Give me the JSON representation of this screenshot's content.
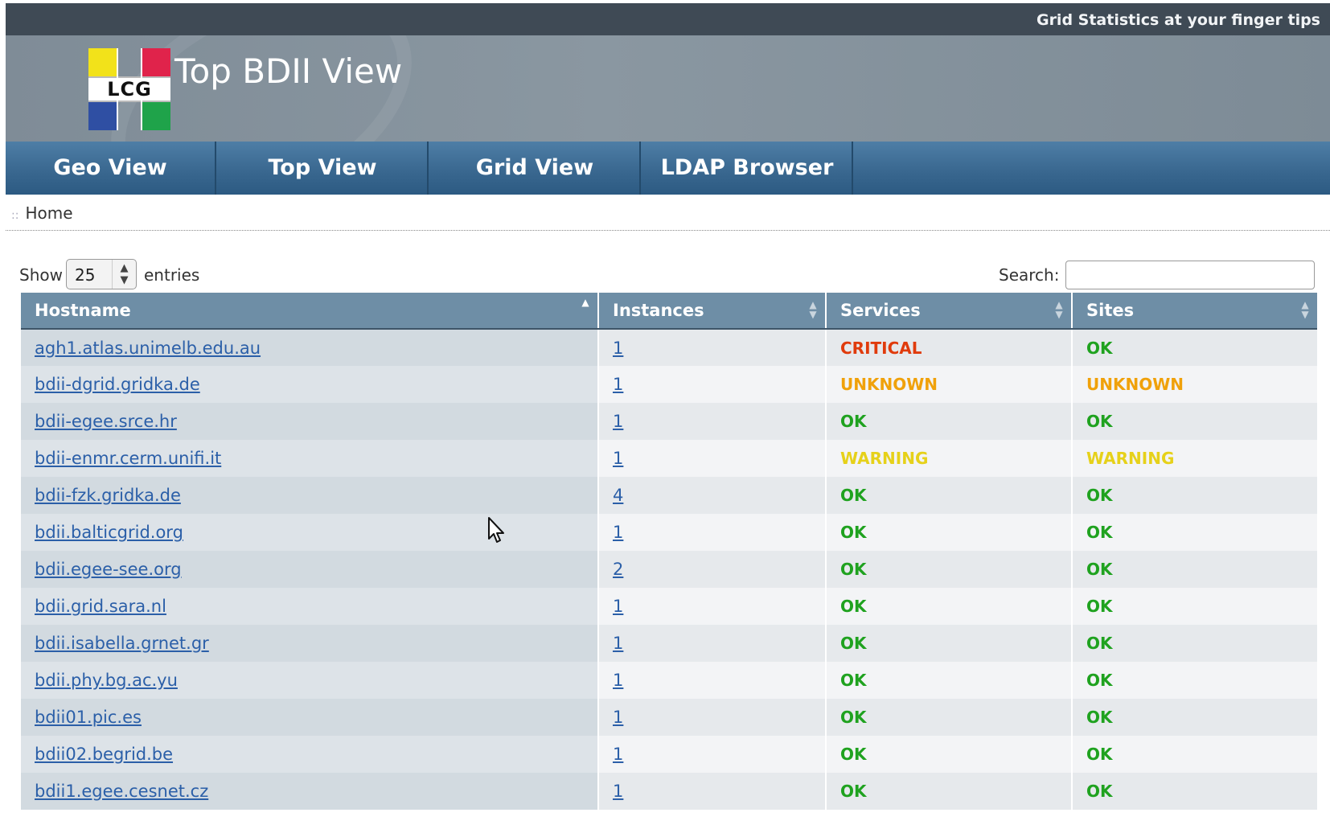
{
  "header": {
    "tagline": "Grid Statistics at your finger tips",
    "title": "Top BDII View",
    "logo_text": "LCG"
  },
  "nav": [
    "Geo View",
    "Top View",
    "Grid View",
    "LDAP Browser"
  ],
  "breadcrumb": {
    "separator": "::",
    "home": "Home"
  },
  "controls": {
    "show_label": "Show",
    "page_length": "25",
    "entries_label": "entries",
    "search_label": "Search:",
    "search_value": ""
  },
  "table": {
    "columns": [
      "Hostname",
      "Instances",
      "Services",
      "Sites"
    ],
    "rows": [
      {
        "host": "agh1.atlas.unimelb.edu.au",
        "instances": "1",
        "services": "CRITICAL",
        "sites": "OK"
      },
      {
        "host": "bdii-dgrid.gridka.de",
        "instances": "1",
        "services": "UNKNOWN",
        "sites": "UNKNOWN"
      },
      {
        "host": "bdii-egee.srce.hr",
        "instances": "1",
        "services": "OK",
        "sites": "OK"
      },
      {
        "host": "bdii-enmr.cerm.unifi.it",
        "instances": "1",
        "services": "WARNING",
        "sites": "WARNING"
      },
      {
        "host": "bdii-fzk.gridka.de",
        "instances": "4",
        "services": "OK",
        "sites": "OK"
      },
      {
        "host": "bdii.balticgrid.org",
        "instances": "1",
        "services": "OK",
        "sites": "OK"
      },
      {
        "host": "bdii.egee-see.org",
        "instances": "2",
        "services": "OK",
        "sites": "OK"
      },
      {
        "host": "bdii.grid.sara.nl",
        "instances": "1",
        "services": "OK",
        "sites": "OK"
      },
      {
        "host": "bdii.isabella.grnet.gr",
        "instances": "1",
        "services": "OK",
        "sites": "OK"
      },
      {
        "host": "bdii.phy.bg.ac.yu",
        "instances": "1",
        "services": "OK",
        "sites": "OK"
      },
      {
        "host": "bdii01.pic.es",
        "instances": "1",
        "services": "OK",
        "sites": "OK"
      },
      {
        "host": "bdii02.begrid.be",
        "instances": "1",
        "services": "OK",
        "sites": "OK"
      },
      {
        "host": "bdii1.egee.cesnet.cz",
        "instances": "1",
        "services": "OK",
        "sites": "OK"
      }
    ]
  },
  "status_colors": {
    "OK": "#1fa21f",
    "CRITICAL": "#e03b0c",
    "UNKNOWN": "#f0a10a",
    "WARNING": "#e6d11a"
  }
}
